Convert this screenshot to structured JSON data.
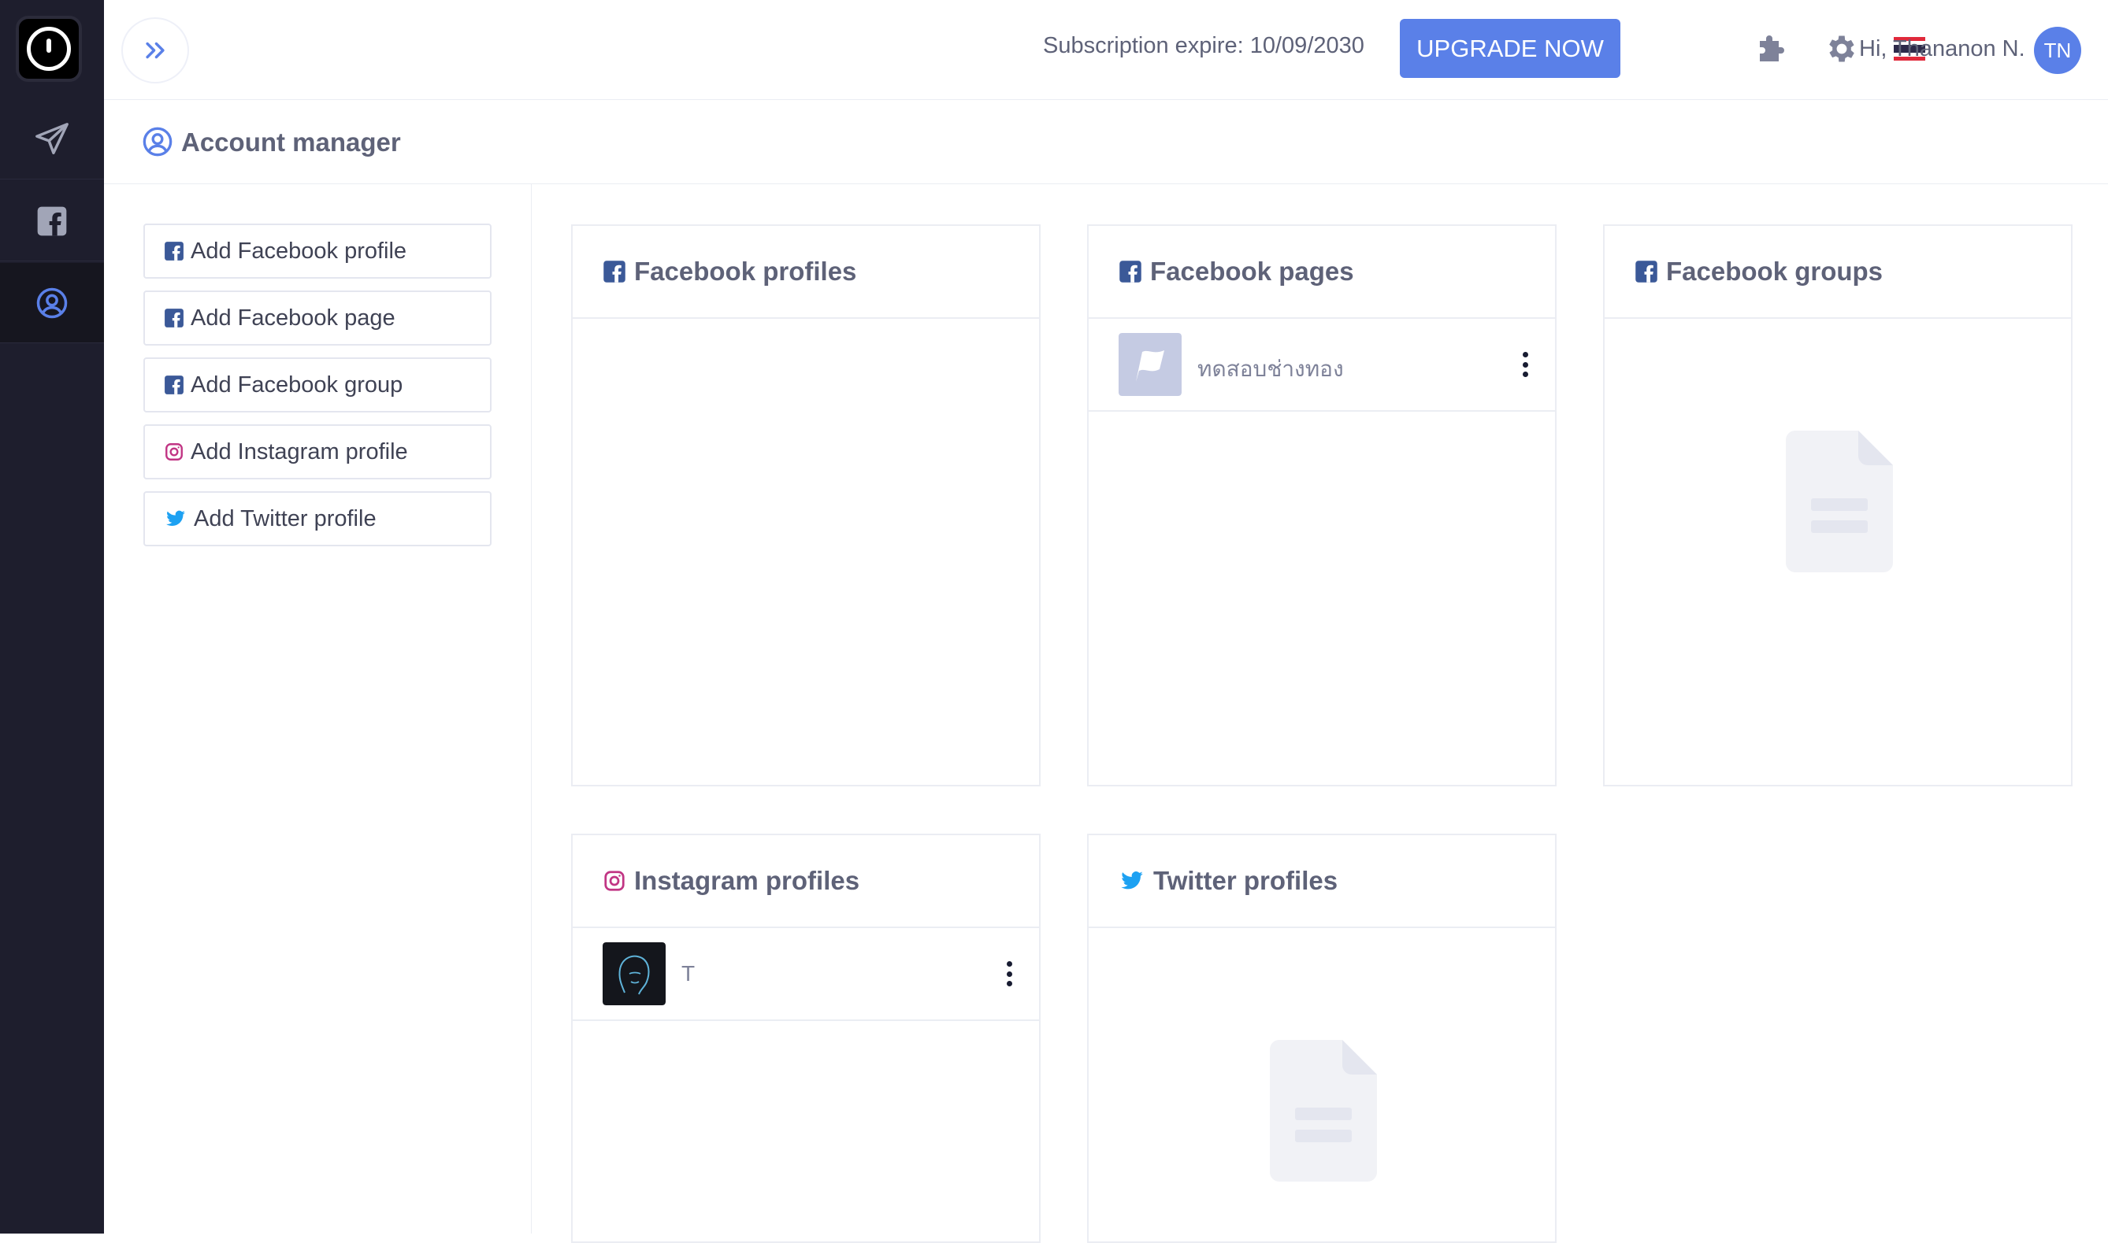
{
  "header": {
    "subscription": "Subscription expire: 10/09/2030",
    "upgrade_label": "UPGRADE NOW",
    "greeting": "Hi, Thananon N.",
    "avatar_initials": "TN"
  },
  "subheader": {
    "title": "Account manager"
  },
  "left_menu": {
    "items": [
      {
        "label": "Add Facebook profile",
        "icon": "facebook-icon"
      },
      {
        "label": "Add Facebook page",
        "icon": "facebook-icon"
      },
      {
        "label": "Add Facebook group",
        "icon": "facebook-icon"
      },
      {
        "label": "Add Instagram profile",
        "icon": "instagram-icon"
      },
      {
        "label": "Add Twitter profile",
        "icon": "twitter-icon"
      }
    ]
  },
  "cards": {
    "facebook_profiles": {
      "title": "Facebook profiles"
    },
    "facebook_pages": {
      "title": "Facebook pages",
      "items": [
        {
          "name": "ทดสอบช่างทอง"
        }
      ]
    },
    "facebook_groups": {
      "title": "Facebook groups"
    },
    "instagram_profiles": {
      "title": "Instagram profiles",
      "items": [
        {
          "name": "T"
        }
      ]
    },
    "twitter_profiles": {
      "title": "Twitter profiles"
    }
  },
  "colors": {
    "accent": "#5a80e8",
    "sidebar": "#1e1e2d",
    "facebook": "#3b5998",
    "instagram": "#c13584",
    "twitter": "#1da1f2"
  }
}
